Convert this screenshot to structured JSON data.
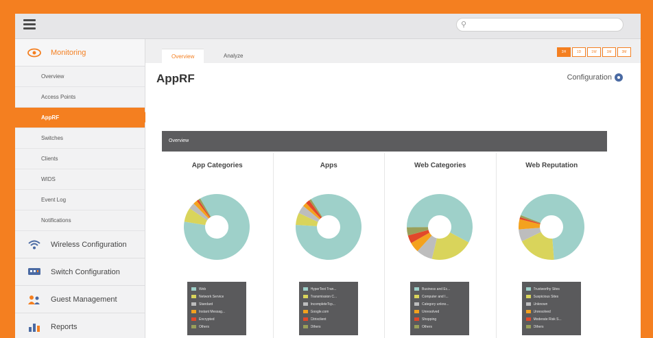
{
  "search": {
    "placeholder": ""
  },
  "sidebar": {
    "monitoring": "Monitoring",
    "items": [
      "Overview",
      "Access Points",
      "AppRF",
      "Switches",
      "Clients",
      "WIDS",
      "Event Log",
      "Notifications"
    ],
    "sections": [
      "Wireless Configuration",
      "Switch Configuration",
      "Guest Management",
      "Reports"
    ]
  },
  "tabs": [
    "Overview",
    "Analyze"
  ],
  "time_buttons": [
    "3H",
    "1D",
    "1W",
    "1M",
    "3M"
  ],
  "page_title": "AppRF",
  "config_label": "Configuration",
  "panel_header": "Overview",
  "colors": {
    "accent": "#f47f20",
    "teal": "#9ed0c9",
    "yellow": "#d9d45b",
    "grey": "#bdbdbd",
    "orange": "#f4a21e",
    "red": "#e2482a",
    "olive": "#9aa05a"
  },
  "cards": [
    {
      "title": "App Categories",
      "legend": [
        "Web",
        "Network Service",
        "Standard",
        "Instant Messag...",
        "Encrypted",
        "Others"
      ],
      "values": [
        86,
        7,
        3,
        2,
        1,
        1
      ]
    },
    {
      "title": "Apps",
      "legend": [
        "HyperText Tran...",
        "Transmission C...",
        "IncompleteTcp...",
        "Google.com",
        "Citrixclient",
        "Others"
      ],
      "values": [
        85,
        6,
        4,
        2,
        2,
        1
      ]
    },
    {
      "title": "Web Categories",
      "legend": [
        "Business and Ec...",
        "Computer and I...",
        "Category unkno...",
        "Unresolved",
        "Shopping",
        "Others"
      ],
      "values": [
        58,
        21,
        8,
        5,
        4,
        4
      ]
    },
    {
      "title": "Web Reputation",
      "legend": [
        "Trustworthy Sites",
        "Suspicious Sites",
        "Unknown",
        "Unresolved",
        "Moderate Risk S...",
        "Others"
      ],
      "values": [
        68,
        19,
        6,
        5,
        1,
        1
      ]
    }
  ]
}
